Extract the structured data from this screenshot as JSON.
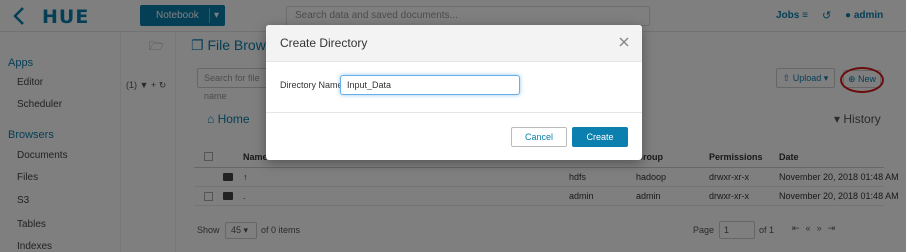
{
  "app": {
    "logo": "HUE"
  },
  "topbar": {
    "notebook_label": "Notebook",
    "search_placeholder": "Search data and saved documents...",
    "jobs_label": "Jobs",
    "user_label": "admin"
  },
  "sidebar": {
    "apps_heading": "Apps",
    "apps_items": [
      "Editor",
      "Scheduler"
    ],
    "browsers_heading": "Browsers",
    "browser_items": [
      "Documents",
      "Files",
      "S3",
      "Tables",
      "Indexes"
    ]
  },
  "assist": {
    "tools_label": "(1)"
  },
  "file_browser": {
    "title": "File Browser",
    "filter_placeholder": "Search for file name",
    "upload_label": "Upload",
    "new_label": "New",
    "home_label": "Home",
    "history_label": "History",
    "columns": [
      "Name",
      "Group",
      "Permissions",
      "Date"
    ],
    "rows": [
      {
        "name": "↑",
        "user": "hdfs",
        "group": "hadoop",
        "permissions": "drwxr-xr-x",
        "date": "November 20, 2018 01:48 AM"
      },
      {
        "name": ".",
        "user": "admin",
        "group": "admin",
        "permissions": "drwxr-xr-x",
        "date": "November 20, 2018 01:48 AM"
      }
    ],
    "footer": {
      "show_label": "Show",
      "page_size": "45",
      "items_label": "of 0 items",
      "page_label": "Page",
      "page_value": "1",
      "of_pages": "of 1"
    }
  },
  "modal": {
    "title": "Create Directory",
    "field_label": "Directory Name",
    "field_value": "Input_Data",
    "cancel_label": "Cancel",
    "create_label": "Create"
  },
  "colors": {
    "accent": "#0B7FAD",
    "highlight": "#d41b1b"
  }
}
